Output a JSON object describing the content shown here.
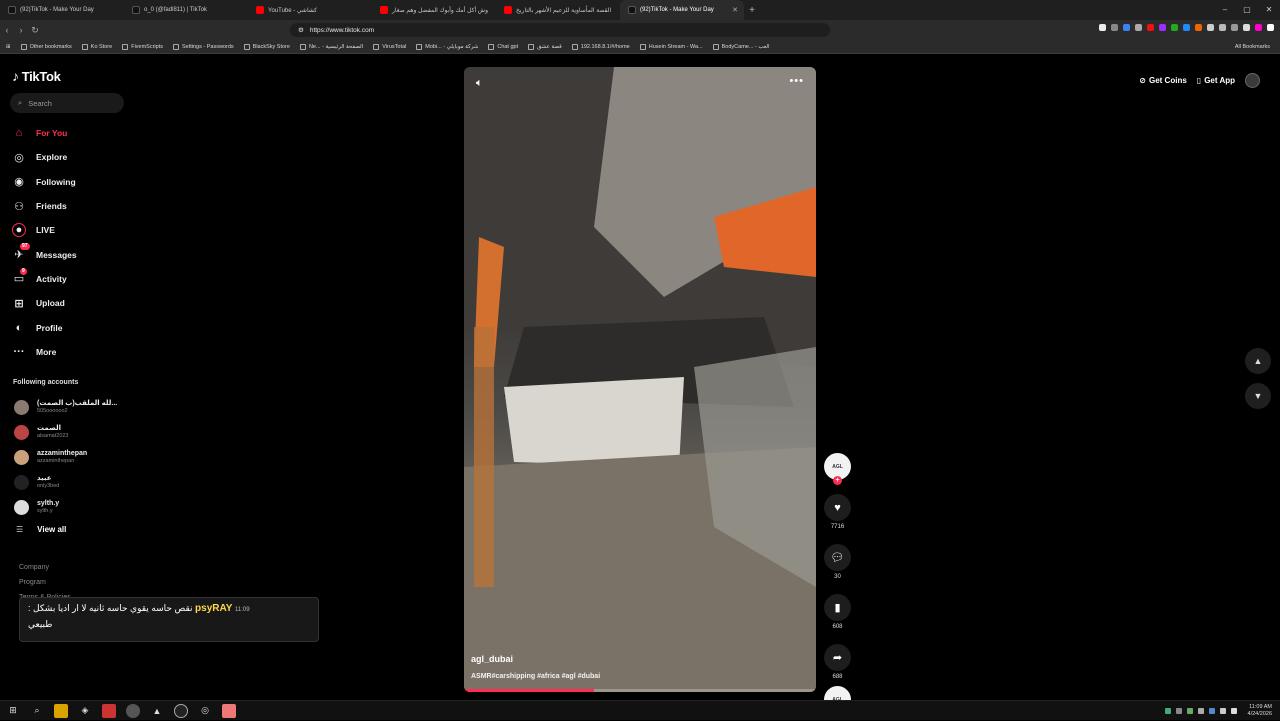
{
  "browser": {
    "tabs": [
      {
        "title": "(92)TikTok - Make Your Day",
        "favicon": "tiktok-icon"
      },
      {
        "title": "o_0 (@fadl811) | TikTok",
        "favicon": "tiktok-icon"
      },
      {
        "title": "YouTube - كشاشي",
        "favicon": "youtube-icon"
      },
      {
        "title": "وش أكل أمك وأبوك المفضل وهم صغار",
        "favicon": "youtube-icon"
      },
      {
        "title": "القصة المأساوية للزعيم الأشهر بالتاريخ",
        "favicon": "youtube-icon"
      },
      {
        "title": "(92)TikTok - Make Your Day",
        "favicon": "tiktok-icon",
        "active": true
      }
    ],
    "url": "https://www.tiktok.com",
    "bookmarks": [
      "Other bookmarks",
      "Ko Store",
      "FivemScripts",
      "Settings - Passwords",
      "BlackSky Store",
      "Ne... - الصفحة الرئيسية",
      "VirusTotal",
      "Mobi... - شركة موبايلي",
      "Chat gpt",
      "قصة عشق",
      "192.168.8.1/#/home",
      "Husein Stream - Wa...",
      "BodyCame... - العب"
    ],
    "all_bookmarks": "All Bookmarks"
  },
  "sidebar": {
    "logo": "TikTok",
    "search_placeholder": "Search",
    "nav": [
      {
        "label": "For You",
        "icon": "home-icon",
        "active": true
      },
      {
        "label": "Explore",
        "icon": "compass-icon"
      },
      {
        "label": "Following",
        "icon": "following-icon"
      },
      {
        "label": "Friends",
        "icon": "friends-icon"
      },
      {
        "label": "LIVE",
        "icon": "live-icon"
      },
      {
        "label": "Messages",
        "icon": "messages-icon",
        "badge": "97"
      },
      {
        "label": "Activity",
        "icon": "activity-icon",
        "badge": "9"
      },
      {
        "label": "Upload",
        "icon": "upload-icon"
      },
      {
        "label": "Profile",
        "icon": "profile-icon"
      },
      {
        "label": "More",
        "icon": "more-icon"
      }
    ],
    "following_title": "Following accounts",
    "accounts": [
      {
        "name": "لله الملقب(ب الصمت)...",
        "handle": "505oooooo2",
        "color": "#8a7a70"
      },
      {
        "name": "الصمت",
        "handle": "alsamat2023",
        "color": "#b44"
      },
      {
        "name": "azzaminthepan",
        "handle": "azzaminthepan",
        "color": "#c9a27c"
      },
      {
        "name": "عبيد",
        "handle": "only3bed",
        "color": "#222"
      },
      {
        "name": "sylth.y",
        "handle": "sylth.y",
        "color": "#ddd"
      }
    ],
    "view_all": "View all",
    "footer": [
      "Company",
      "Program",
      "Terms & Policies"
    ]
  },
  "chat_overlay": {
    "time": "11:09",
    "user": "psyRAY",
    "message_line1": "نقص حاسه يقوي حاسه ثانيه لا ار اديا بشكل :",
    "message_line2": "طبيعي"
  },
  "video": {
    "author": "agl_dubai",
    "caption": "ASMR#carshipping #africa #agl #dubai",
    "progress": 0.37
  },
  "rail": {
    "avatar_text": "AGL",
    "likes": "7716",
    "comments": "30",
    "saves": "608",
    "shares": "688"
  },
  "header": {
    "get_coins": "Get Coins",
    "get_app": "Get App"
  },
  "taskbar": {
    "time": "11:09 AM",
    "date": "4/24/2026"
  }
}
